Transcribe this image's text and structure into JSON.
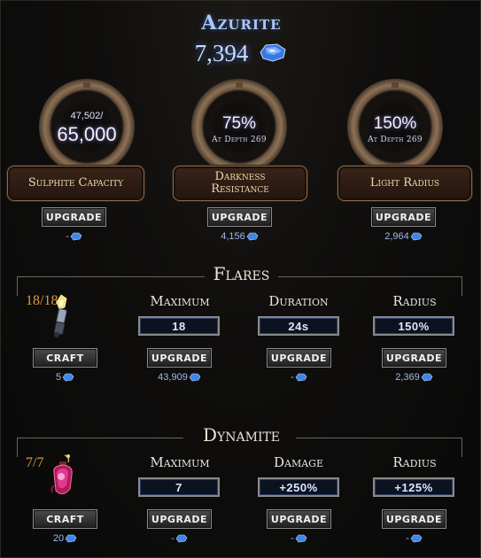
{
  "header": {
    "title": "Azurite",
    "total": "7,394"
  },
  "upgrades": [
    {
      "top_small": "47,502/",
      "top_big": "65,000",
      "label_line1": "Sulphite Capacity",
      "label_line2": "",
      "button": "UPGRADE",
      "cost": "-"
    },
    {
      "top_big": "75%",
      "depth": "At Depth 269",
      "label_line1": "Darkness",
      "label_line2": "Resistance",
      "button": "UPGRADE",
      "cost": "4,156"
    },
    {
      "top_big": "150%",
      "depth": "At Depth 269",
      "label_line1": "Light Radius",
      "label_line2": "",
      "button": "UPGRADE",
      "cost": "2,964"
    }
  ],
  "flares": {
    "title": "Flares",
    "count": "18/18",
    "craft_button": "CRAFT",
    "craft_cost": "5",
    "stats": [
      {
        "label": "Maximum",
        "value": "18",
        "button": "UPGRADE",
        "cost": "43,909"
      },
      {
        "label": "Duration",
        "value": "24s",
        "button": "UPGRADE",
        "cost": "-"
      },
      {
        "label": "Radius",
        "value": "150%",
        "button": "UPGRADE",
        "cost": "2,369"
      }
    ]
  },
  "dynamite": {
    "title": "Dynamite",
    "count": "7/7",
    "craft_button": "CRAFT",
    "craft_cost": "20",
    "stats": [
      {
        "label": "Maximum",
        "value": "7",
        "button": "UPGRADE",
        "cost": "-"
      },
      {
        "label": "Damage",
        "value": "+250%",
        "button": "UPGRADE",
        "cost": "-"
      },
      {
        "label": "Radius",
        "value": "+125%",
        "button": "UPGRADE",
        "cost": "-"
      }
    ]
  },
  "icons": {
    "currency": "azurite-icon",
    "flare": "flare-icon",
    "dynamite": "dynamite-icon"
  },
  "colors": {
    "azurite_blue": "#a9c7f6",
    "count_orange": "#d89a48",
    "plate_text": "#f0d8b0"
  }
}
